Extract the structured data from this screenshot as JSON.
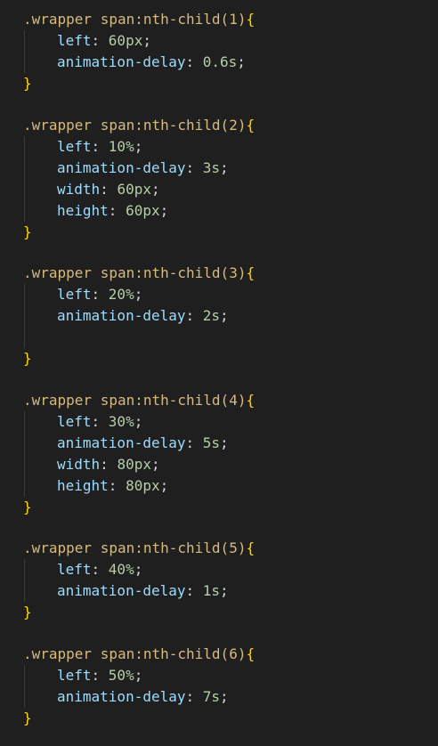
{
  "code": {
    "blocks": [
      {
        "selector": ".wrapper span:nth-child(1)",
        "open": "{",
        "close": "}",
        "declarations": [
          {
            "prop": "left",
            "value": "60px"
          },
          {
            "prop": "animation-delay",
            "value": "0.6s"
          }
        ]
      },
      {
        "selector": ".wrapper span:nth-child(2)",
        "open": "{",
        "close": "}",
        "declarations": [
          {
            "prop": "left",
            "value": "10%"
          },
          {
            "prop": "animation-delay",
            "value": "3s"
          },
          {
            "prop": "width",
            "value": "60px"
          },
          {
            "prop": "height",
            "value": "60px"
          }
        ]
      },
      {
        "selector": ".wrapper span:nth-child(3)",
        "open": "{",
        "close": "}",
        "declarations": [
          {
            "prop": "left",
            "value": "20%"
          },
          {
            "prop": "animation-delay",
            "value": "2s"
          }
        ]
      },
      {
        "selector": ".wrapper span:nth-child(4)",
        "open": "{",
        "close": "}",
        "declarations": [
          {
            "prop": "left",
            "value": "30%"
          },
          {
            "prop": "animation-delay",
            "value": "5s"
          },
          {
            "prop": "width",
            "value": "80px"
          },
          {
            "prop": "height",
            "value": "80px"
          }
        ]
      },
      {
        "selector": ".wrapper span:nth-child(5)",
        "open": "{",
        "close": "}",
        "declarations": [
          {
            "prop": "left",
            "value": "40%"
          },
          {
            "prop": "animation-delay",
            "value": "1s"
          }
        ]
      },
      {
        "selector": ".wrapper span:nth-child(6)",
        "open": "{",
        "close": "}",
        "declarations": [
          {
            "prop": "left",
            "value": "50%"
          },
          {
            "prop": "animation-delay",
            "value": "7s"
          }
        ]
      }
    ]
  }
}
